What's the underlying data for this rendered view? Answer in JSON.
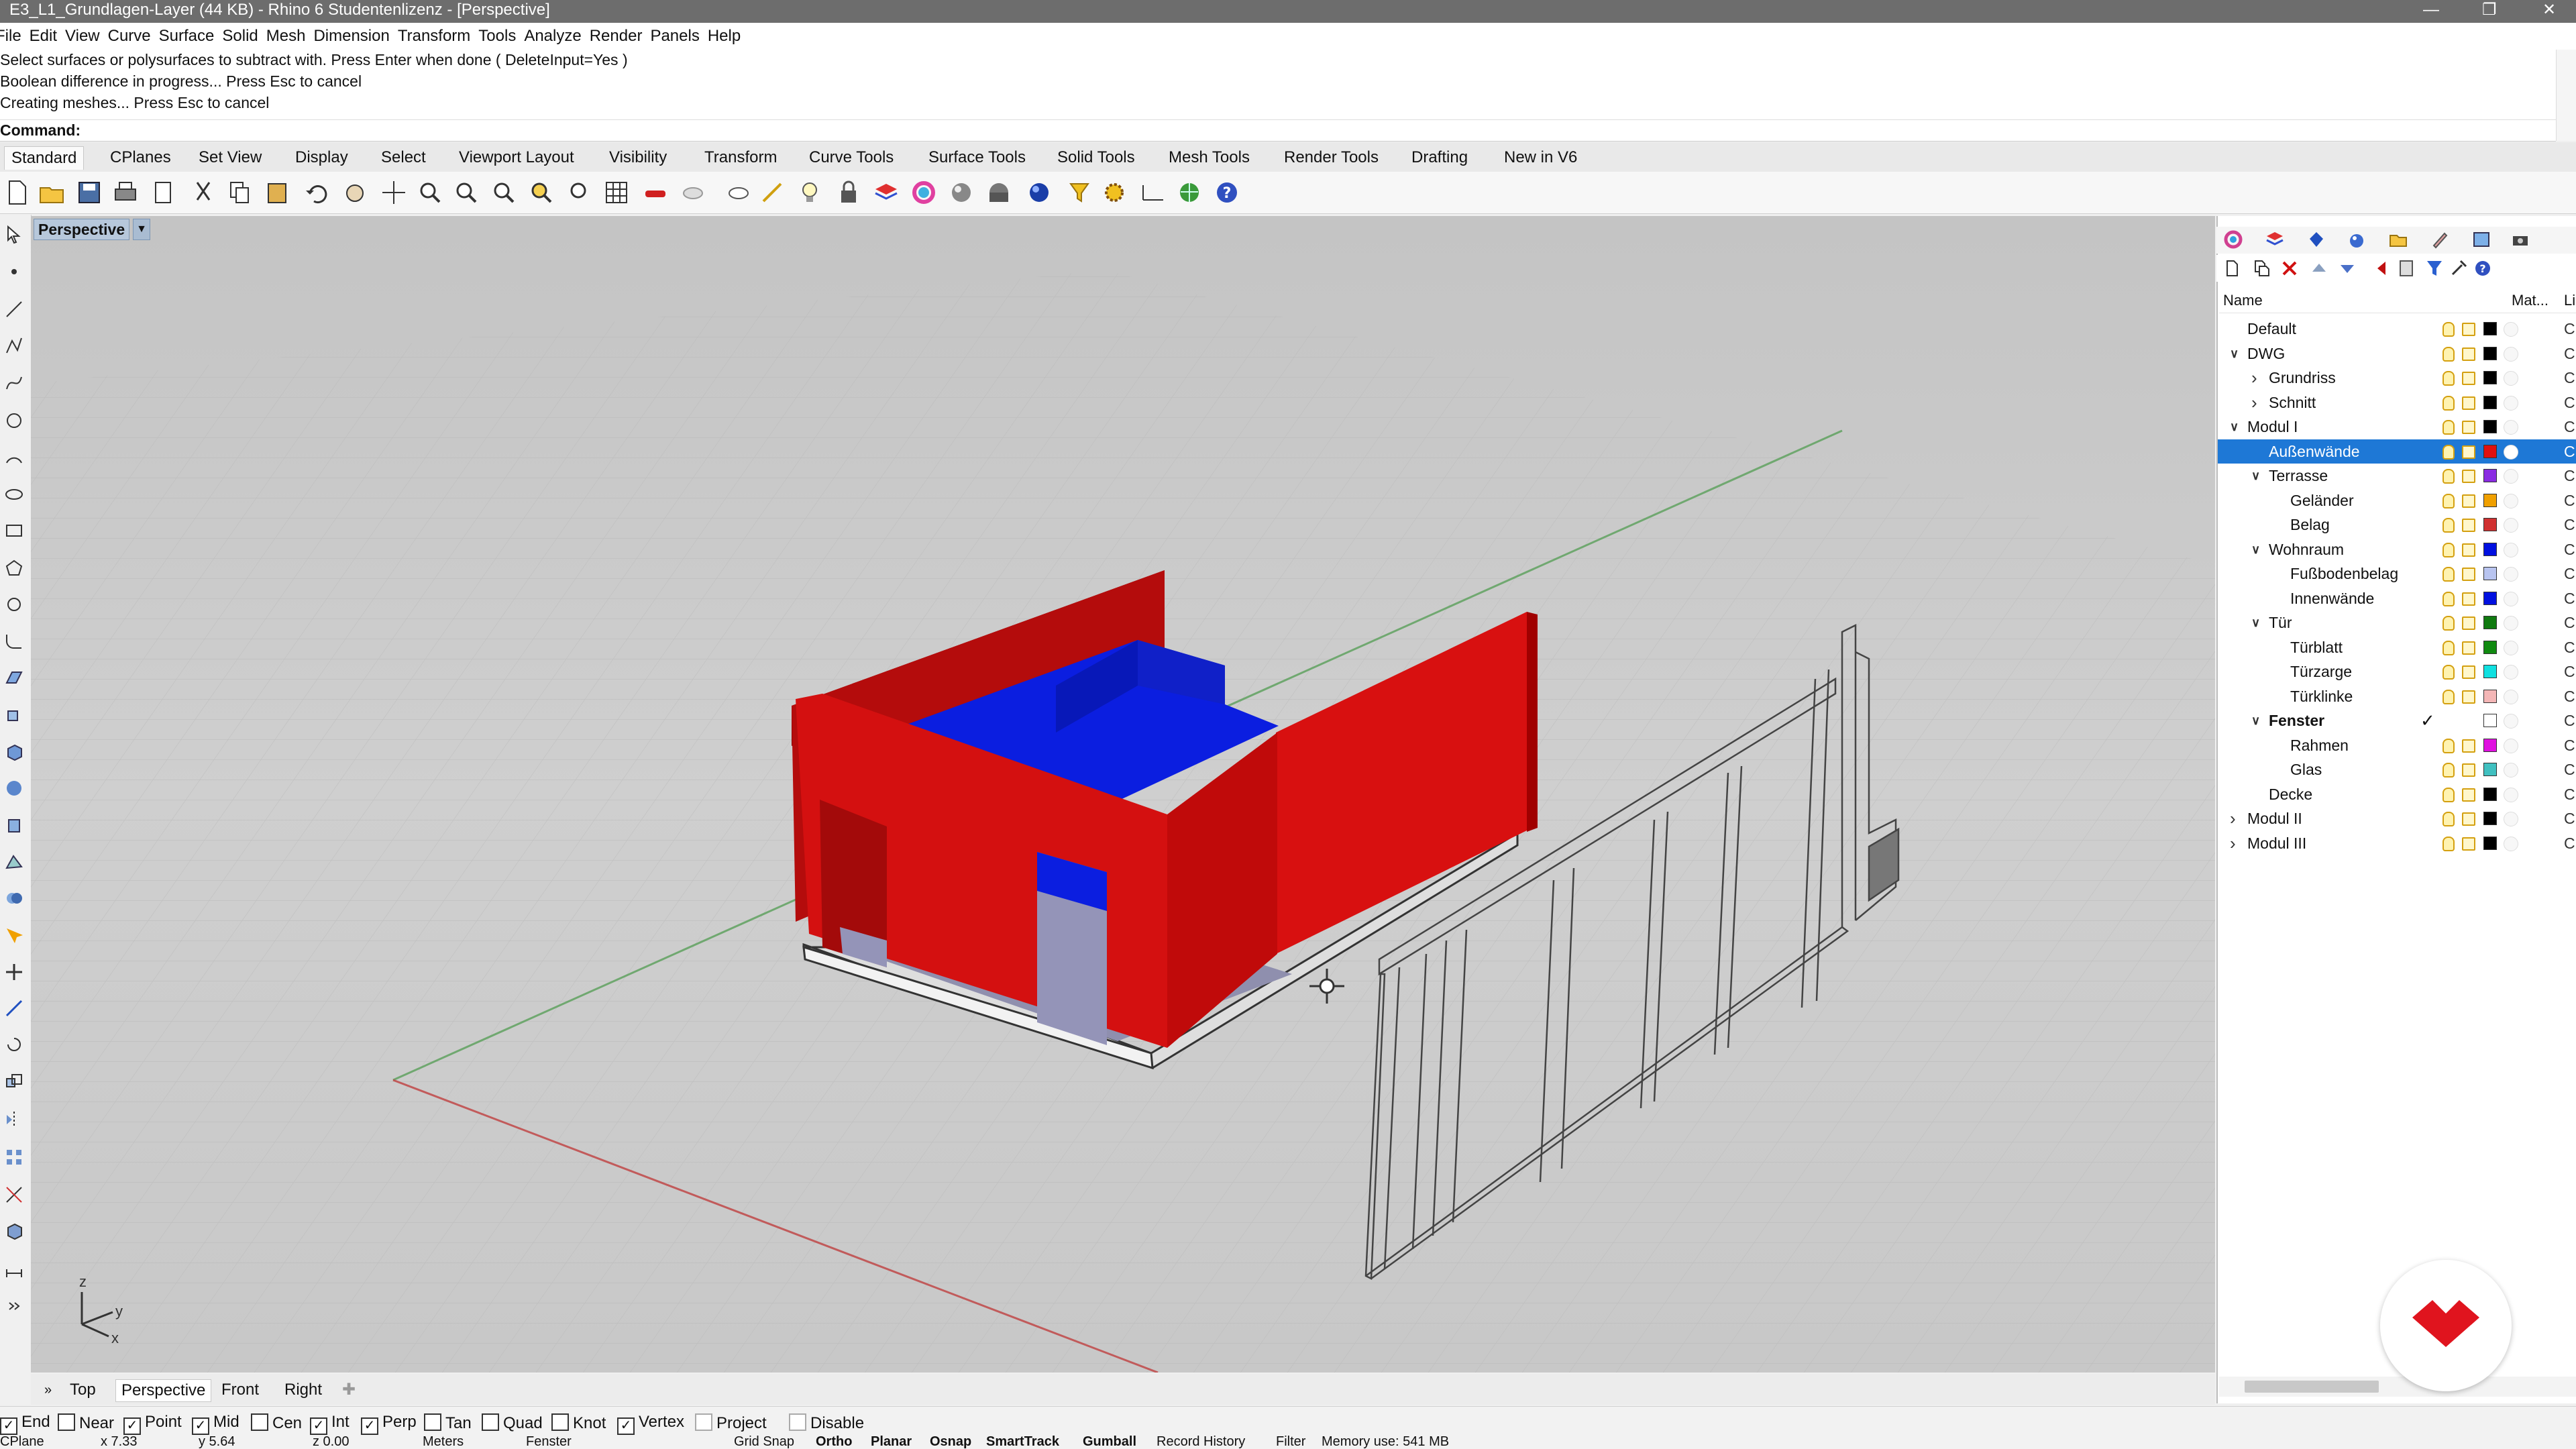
{
  "window": {
    "title": "E3_L1_Grundlagen-Layer (44 KB) - Rhino 6 Studentenlizenz - [Perspective]"
  },
  "menu": [
    "File",
    "Edit",
    "View",
    "Curve",
    "Surface",
    "Solid",
    "Mesh",
    "Dimension",
    "Transform",
    "Tools",
    "Analyze",
    "Render",
    "Panels",
    "Help"
  ],
  "command_history": [
    "Select surfaces or polysurfaces to subtract with. Press Enter when done ( DeleteInput=Yes )",
    "Boolean difference in progress... Press Esc to cancel",
    "Creating meshes... Press Esc to cancel"
  ],
  "command_prompt": "Command:",
  "toolbar_tabs": [
    "Standard",
    "CPlanes",
    "Set View",
    "Display",
    "Select",
    "Viewport Layout",
    "Visibility",
    "Transform",
    "Curve Tools",
    "Surface Tools",
    "Solid Tools",
    "Mesh Tools",
    "Render Tools",
    "Drafting",
    "New in V6"
  ],
  "viewport": {
    "name": "Perspective",
    "axis_x": "x",
    "axis_y": "y",
    "axis_z": "z"
  },
  "view_tabs": [
    "Top",
    "Perspective",
    "Front",
    "Right"
  ],
  "osnaps": [
    {
      "label": "End",
      "checked": true
    },
    {
      "label": "Near",
      "checked": false
    },
    {
      "label": "Point",
      "checked": true
    },
    {
      "label": "Mid",
      "checked": true
    },
    {
      "label": "Cen",
      "checked": false
    },
    {
      "label": "Int",
      "checked": true
    },
    {
      "label": "Perp",
      "checked": true
    },
    {
      "label": "Tan",
      "checked": false
    },
    {
      "label": "Quad",
      "checked": false
    },
    {
      "label": "Knot",
      "checked": false
    },
    {
      "label": "Vertex",
      "checked": true
    },
    {
      "label": "Project",
      "checked": false
    },
    {
      "label": "Disable",
      "checked": false
    }
  ],
  "status": {
    "cplane": "CPlane",
    "x": "x 7.33",
    "y": "y 5.64",
    "z": "z 0.00",
    "units": "Meters",
    "layer": "Fenster",
    "grid_snap": "Grid Snap",
    "ortho": "Ortho",
    "planar": "Planar",
    "osnap": "Osnap",
    "smarttrack": "SmartTrack",
    "gumball": "Gumball",
    "record_history": "Record History",
    "filter": "Filter",
    "memory": "Memory use: 541 MB"
  },
  "layers_panel": {
    "col_name": "Name",
    "col_material": "Mat...",
    "col_linetype": "Li",
    "layers": [
      {
        "name": "Default",
        "indent": 0,
        "arrow": "",
        "color": "#000000",
        "lt": "C"
      },
      {
        "name": "DWG",
        "indent": 0,
        "arrow": "down",
        "color": "#000000",
        "lt": "C"
      },
      {
        "name": "Grundriss",
        "indent": 1,
        "arrow": "right",
        "color": "#000000",
        "lt": "C"
      },
      {
        "name": "Schnitt",
        "indent": 1,
        "arrow": "right",
        "color": "#000000",
        "lt": "C"
      },
      {
        "name": "Modul I",
        "indent": 0,
        "arrow": "down",
        "color": "#000000",
        "lt": "C"
      },
      {
        "name": "Außenwände",
        "indent": 1,
        "arrow": "",
        "color": "#e01010",
        "lt": "C",
        "selected": true
      },
      {
        "name": "Terrasse",
        "indent": 1,
        "arrow": "down",
        "color": "#8a2be2",
        "lt": "C"
      },
      {
        "name": "Geländer",
        "indent": 2,
        "arrow": "",
        "color": "#f0a000",
        "lt": "C"
      },
      {
        "name": "Belag",
        "indent": 2,
        "arrow": "",
        "color": "#d03030",
        "lt": "C"
      },
      {
        "name": "Wohnraum",
        "indent": 1,
        "arrow": "down",
        "color": "#0010e0",
        "lt": "C"
      },
      {
        "name": "Fußbodenbelag",
        "indent": 2,
        "arrow": "",
        "color": "#b8c4f0",
        "lt": "C"
      },
      {
        "name": "Innenwände",
        "indent": 2,
        "arrow": "",
        "color": "#0010e0",
        "lt": "C"
      },
      {
        "name": "Tür",
        "indent": 1,
        "arrow": "down",
        "color": "#107a10",
        "lt": "C"
      },
      {
        "name": "Türblatt",
        "indent": 2,
        "arrow": "",
        "color": "#108a10",
        "lt": "C"
      },
      {
        "name": "Türzarge",
        "indent": 2,
        "arrow": "",
        "color": "#10e0e0",
        "lt": "C"
      },
      {
        "name": "Türklinke",
        "indent": 2,
        "arrow": "",
        "color": "#f4b6b6",
        "lt": "C"
      },
      {
        "name": "Fenster",
        "indent": 1,
        "arrow": "down",
        "color": "#ffffff",
        "lt": "C",
        "current": true
      },
      {
        "name": "Rahmen",
        "indent": 2,
        "arrow": "",
        "color": "#e010e0",
        "lt": "C"
      },
      {
        "name": "Glas",
        "indent": 2,
        "arrow": "",
        "color": "#40c0c0",
        "lt": "C"
      },
      {
        "name": "Decke",
        "indent": 1,
        "arrow": "",
        "color": "#000000",
        "lt": "C"
      },
      {
        "name": "Modul II",
        "indent": 0,
        "arrow": "right",
        "color": "#000000",
        "lt": "C"
      },
      {
        "name": "Modul III",
        "indent": 0,
        "arrow": "right",
        "color": "#000000",
        "lt": "C"
      }
    ]
  },
  "colors": {
    "selection": "#1e78d6",
    "wall": "#d81010",
    "floor_blue": "#0b1ee0",
    "logo": "#e0141e"
  },
  "icons": [
    "new-icon",
    "open-icon",
    "save-icon",
    "print-icon",
    "cut-icon",
    "copy-icon",
    "paste-icon",
    "undo-icon",
    "pan-icon",
    "zoom-icon",
    "layer-icon",
    "lock-icon",
    "render-icon",
    "help-icon"
  ]
}
